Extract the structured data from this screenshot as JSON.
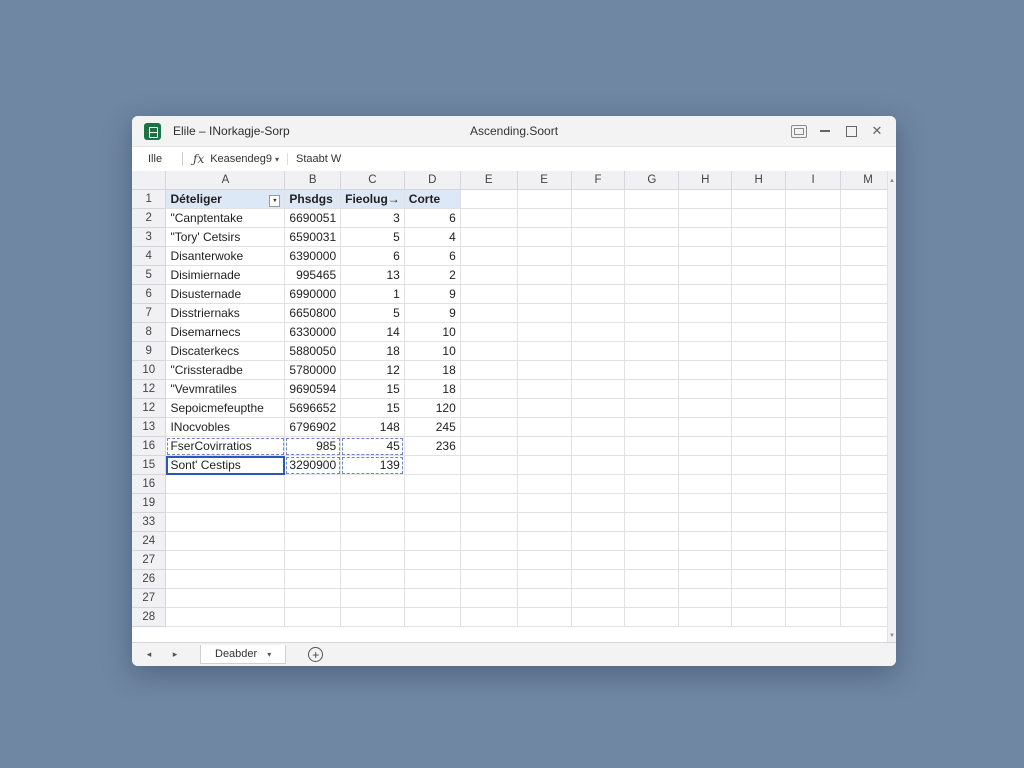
{
  "titlebar": {
    "title_left": "Elile – INorkagje-Sorp",
    "title_center": "Ascending.Soort"
  },
  "formula_bar": {
    "name_box": "Ille",
    "fx": "ƒx",
    "field_value": "Keasendeg9",
    "dropdown_arrow": "▾",
    "second_box": "Staabt W"
  },
  "grid": {
    "columns": [
      "A",
      "B",
      "C",
      "D",
      "E",
      "E",
      "F",
      "G",
      "H",
      "H",
      "I",
      "M"
    ],
    "rows": [
      {
        "num": "1",
        "cells": [
          "Dételiger",
          "Phsdgs",
          "Fieolug→",
          "Corte"
        ]
      },
      {
        "num": "2",
        "cells": [
          "\"Canptentake",
          "6690051",
          "3",
          "6"
        ]
      },
      {
        "num": "3",
        "cells": [
          "\"Tory' Cetsirs",
          "6590031",
          "5",
          "4"
        ]
      },
      {
        "num": "4",
        "cells": [
          "Disanterwoke",
          "6390000",
          "6",
          "6"
        ]
      },
      {
        "num": "5",
        "cells": [
          "Disimiernade",
          "995465",
          "13",
          "2"
        ]
      },
      {
        "num": "6",
        "cells": [
          "Disusternade",
          "6990000",
          "1",
          "9"
        ]
      },
      {
        "num": "7",
        "cells": [
          "Disstriernaks",
          "6650800",
          "5",
          "9"
        ]
      },
      {
        "num": "8",
        "cells": [
          "Disemarnecs",
          "6330000",
          "14",
          "10"
        ]
      },
      {
        "num": "9",
        "cells": [
          "Discaterkecs",
          "5880050",
          "18",
          "10"
        ]
      },
      {
        "num": "10",
        "cells": [
          "\"Crissteradbe",
          "5780000",
          "12",
          "18"
        ]
      },
      {
        "num": "12",
        "cells": [
          "\"Vevmratiles",
          "9690594",
          "15",
          "18"
        ]
      },
      {
        "num": "12",
        "cells": [
          "Sepoicmefeupthe",
          "5696652",
          "15",
          "120"
        ]
      },
      {
        "num": "13",
        "cells": [
          "INocvobles",
          "6796902",
          "148",
          "245"
        ]
      },
      {
        "num": "16",
        "cells": [
          "FserCovirratios",
          "985",
          "45",
          "236"
        ]
      },
      {
        "num": "15",
        "cells": [
          "Sont' Cestips",
          "3290900",
          "139",
          ""
        ]
      },
      {
        "num": "16",
        "cells": [
          "",
          "",
          "",
          ""
        ]
      },
      {
        "num": "19",
        "cells": [
          "",
          "",
          "",
          ""
        ]
      },
      {
        "num": "33",
        "cells": [
          "",
          "",
          "",
          ""
        ]
      },
      {
        "num": "24",
        "cells": [
          "",
          "",
          "",
          ""
        ]
      },
      {
        "num": "27",
        "cells": [
          "",
          "",
          "",
          ""
        ]
      },
      {
        "num": "26",
        "cells": [
          "",
          "",
          "",
          ""
        ]
      },
      {
        "num": "27",
        "cells": [
          "",
          "",
          "",
          ""
        ]
      },
      {
        "num": "28",
        "cells": [
          "",
          "",
          "",
          ""
        ]
      }
    ]
  },
  "sheets": {
    "nav_prev": "◂",
    "nav_next": "▸",
    "active_tab": "Deabder",
    "tab_arrow": "▾",
    "add": "+"
  },
  "colors": {
    "header_highlight": "#dde8f7",
    "selection": "#2b57b8",
    "app_icon": "#1e7145",
    "desktop": "#6f87a3"
  }
}
